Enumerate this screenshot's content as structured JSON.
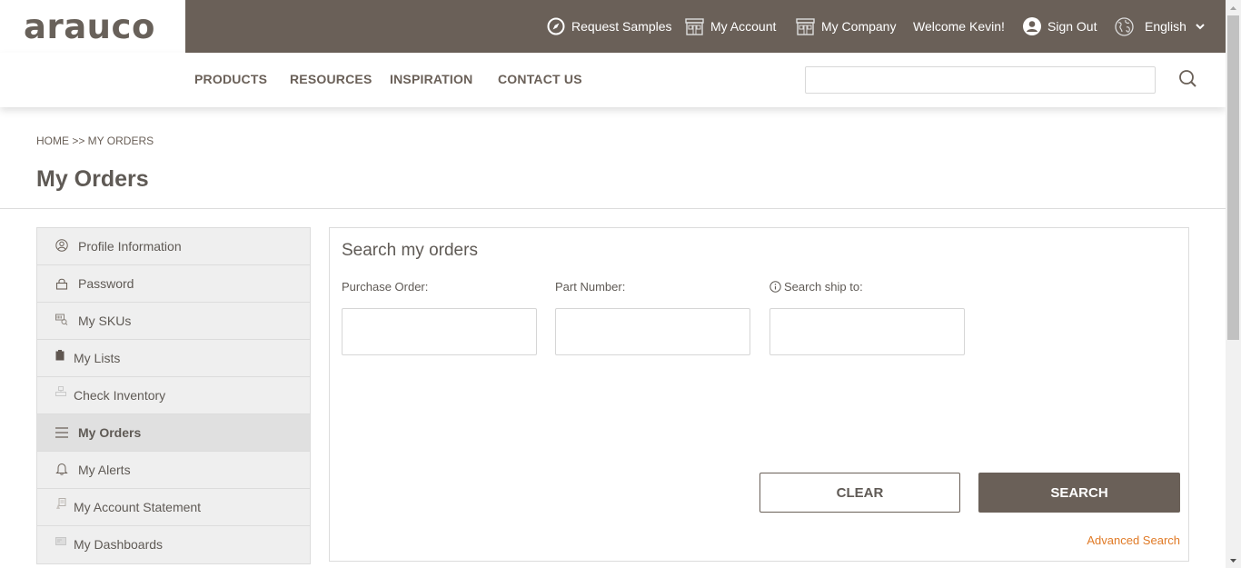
{
  "brand": {
    "logo_text": "arauco"
  },
  "utility_nav": {
    "request_samples": "Request Samples",
    "my_account": "My Account",
    "my_company": "My Company",
    "welcome": "Welcome Kevin!",
    "sign_out": "Sign Out",
    "language": "English"
  },
  "main_nav": {
    "items": [
      "PRODUCTS",
      "RESOURCES",
      "INSPIRATION",
      "CONTACT US"
    ],
    "search_value": "",
    "search_placeholder": ""
  },
  "breadcrumb": "HOME >> MY ORDERS",
  "page_title": "My Orders",
  "sidebar": {
    "items": [
      {
        "label": "Profile Information",
        "icon": "user-circle-icon"
      },
      {
        "label": "Password",
        "icon": "lock-icon"
      },
      {
        "label": "My SKUs",
        "icon": "sku-search-icon"
      },
      {
        "label": "My Lists",
        "icon": "clipboard-icon"
      },
      {
        "label": "Check Inventory",
        "icon": "inventory-icon"
      },
      {
        "label": "My Orders",
        "icon": "list-icon",
        "active": true
      },
      {
        "label": "My Alerts",
        "icon": "bell-icon"
      },
      {
        "label": "My Account Statement",
        "icon": "statement-icon"
      },
      {
        "label": "My Dashboards",
        "icon": "dashboard-icon"
      }
    ]
  },
  "search_panel": {
    "title": "Search my orders",
    "fields": [
      {
        "label": "Purchase Order:",
        "value": ""
      },
      {
        "label": "Part Number:",
        "value": ""
      },
      {
        "label": "Search ship to:",
        "value": "",
        "info_icon": true
      }
    ],
    "clear_label": "CLEAR",
    "search_label": "SEARCH",
    "advanced_link": "Advanced Search"
  },
  "colors": {
    "brand_brown": "#6a6058",
    "link_orange": "#e07a26",
    "sidebar_bg": "#efefef",
    "sidebar_active_bg": "#e0e0e0"
  }
}
